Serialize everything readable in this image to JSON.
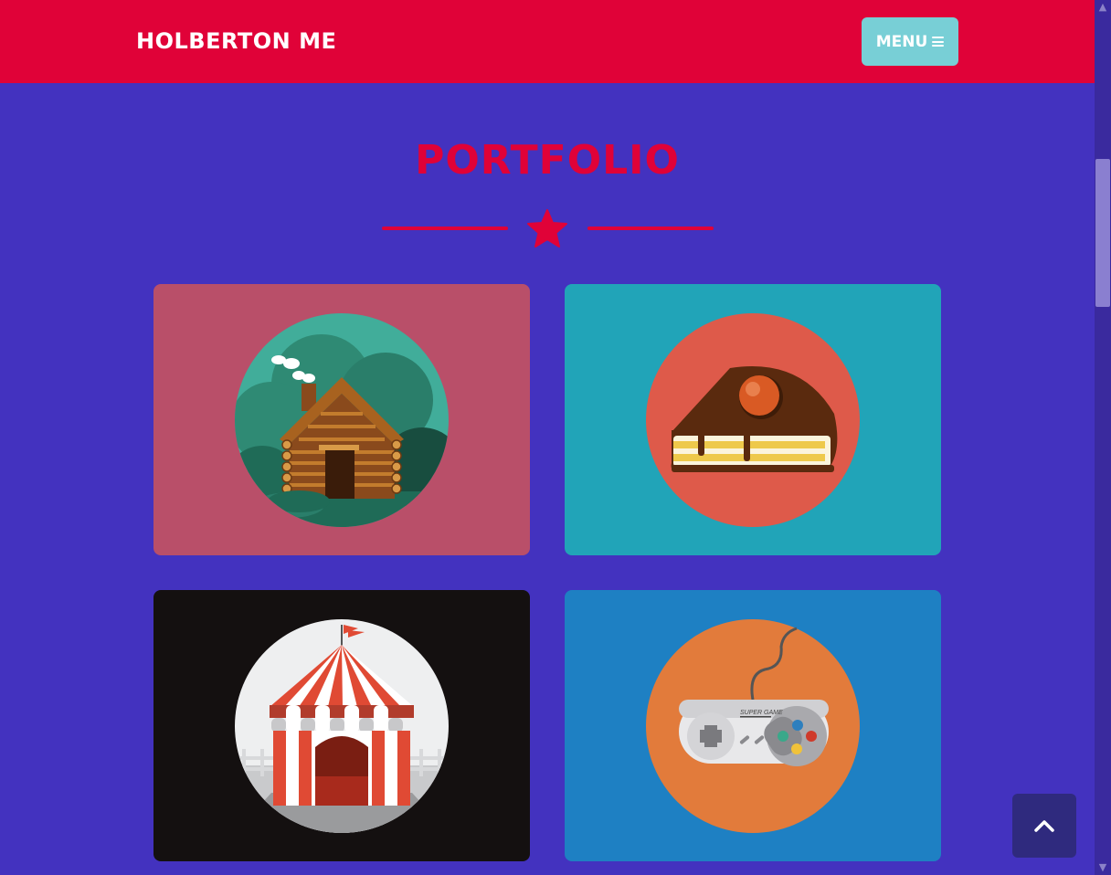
{
  "navbar": {
    "brand": "HOLBERTON ME",
    "menu_label": "MENU",
    "menu_icon": "hamburger-icon",
    "background": "#e00238"
  },
  "portfolio": {
    "title": "PORTFOLIO",
    "divider_icon": "star-icon",
    "accent_color": "#e00238",
    "items": [
      {
        "name": "cabin",
        "icon": "log-cabin-icon",
        "card_color": "#b94f69",
        "circle_color": "#41ad9a"
      },
      {
        "name": "cake",
        "icon": "cake-slice-icon",
        "card_color": "#21a4b8",
        "circle_color": "#de5a4a"
      },
      {
        "name": "circus",
        "icon": "circus-tent-icon",
        "card_color": "#141010",
        "circle_color": "#eeeff0"
      },
      {
        "name": "game",
        "icon": "game-controller-icon",
        "card_color": "#1e80c3",
        "circle_color": "#e27b3b"
      }
    ],
    "controller_label": "SUPER GAME"
  },
  "back_to_top": {
    "icon": "chevron-up-icon"
  },
  "scrollbar": {
    "up_icon": "scroll-up-arrow-icon",
    "down_icon": "scroll-down-arrow-icon"
  }
}
